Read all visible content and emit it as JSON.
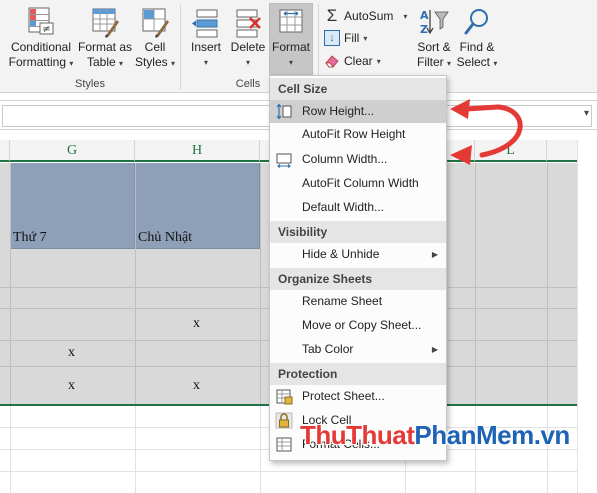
{
  "ribbon": {
    "styles": {
      "conditional_formatting": {
        "line1": "Conditional",
        "line2": "Formatting"
      },
      "format_as_table": {
        "line1": "Format as",
        "line2": "Table"
      },
      "cell_styles": {
        "line1": "Cell",
        "line2": "Styles"
      },
      "group_label": "Styles"
    },
    "cells": {
      "insert": "Insert",
      "delete": "Delete",
      "format": "Format",
      "group_label": "Cells"
    },
    "editing": {
      "autosum": "AutoSum",
      "fill": "Fill",
      "clear": "Clear",
      "sort_filter": {
        "line1": "Sort &",
        "line2": "Filter"
      },
      "find_select": {
        "line1": "Find &",
        "line2": "Select"
      }
    }
  },
  "columns": [
    "G",
    "H",
    "L"
  ],
  "cells": {
    "g_header": "Thứ 7",
    "h_header": "Chủ Nhật",
    "h_row3": "x",
    "g_row4": "x",
    "g_row5": "x",
    "h_row5": "x"
  },
  "menu": {
    "cell_size": "Cell Size",
    "row_height": "Row Height...",
    "autofit_row_height": "AutoFit Row Height",
    "column_width": "Column Width...",
    "autofit_column_width": "AutoFit Column Width",
    "default_width": "Default Width...",
    "visibility": "Visibility",
    "hide_unhide": "Hide & Unhide",
    "organize_sheets": "Organize Sheets",
    "rename_sheet": "Rename Sheet",
    "move_copy_sheet": "Move or Copy Sheet...",
    "tab_color": "Tab Color",
    "protection": "Protection",
    "protect_sheet": "Protect Sheet...",
    "lock_cell": "Lock Cell",
    "format_cells": "Format Cells..."
  },
  "watermark": {
    "part1": "ThuThuat",
    "part2": "PhanMem",
    "part3": ".vn"
  },
  "colors": {
    "accent_green": "#217346",
    "header_fill": "#8ea0b8",
    "cell_fill": "#d9d9d9",
    "arrow_red": "#e53935",
    "watermark_blue": "#1e63b6"
  }
}
